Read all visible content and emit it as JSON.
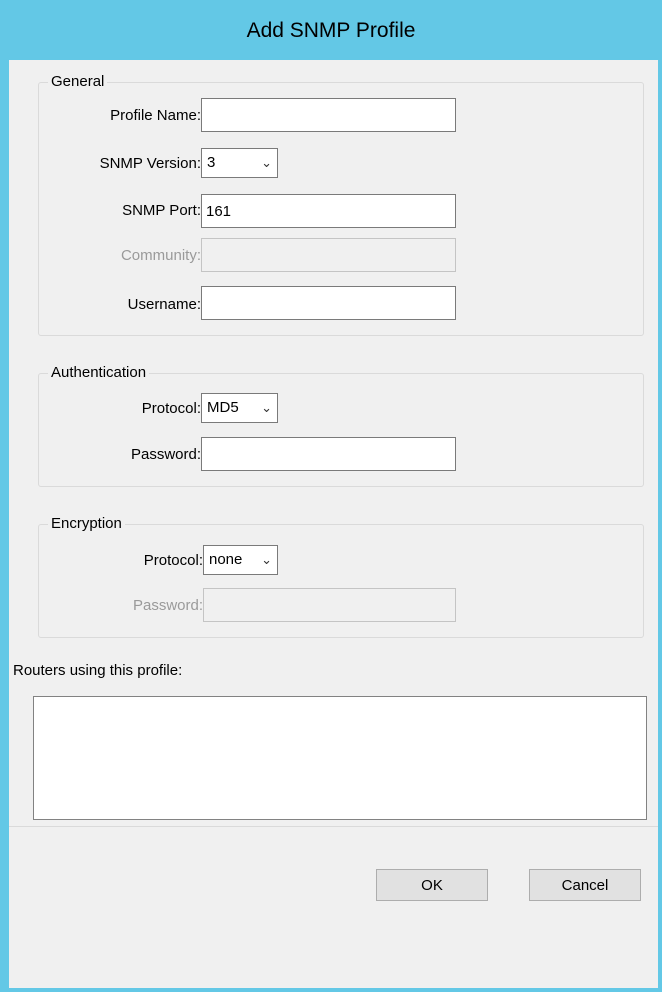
{
  "window": {
    "title": "Add SNMP Profile"
  },
  "general": {
    "legend": "General",
    "profile_name": {
      "label": "Profile Name:",
      "value": ""
    },
    "snmp_version": {
      "label": "SNMP Version:",
      "value": "3"
    },
    "snmp_port": {
      "label": "SNMP Port:",
      "value": "161"
    },
    "community": {
      "label": "Community:",
      "value": "",
      "enabled": false
    },
    "username": {
      "label": "Username:",
      "value": ""
    }
  },
  "authentication": {
    "legend": "Authentication",
    "protocol": {
      "label": "Protocol:",
      "value": "MD5"
    },
    "password": {
      "label": "Password:",
      "value": ""
    }
  },
  "encryption": {
    "legend": "Encryption",
    "protocol": {
      "label": "Protocol:",
      "value": "none"
    },
    "password": {
      "label": "Password:",
      "value": "",
      "enabled": false
    }
  },
  "routers": {
    "label": "Routers using this profile:",
    "items": []
  },
  "buttons": {
    "ok": "OK",
    "cancel": "Cancel"
  },
  "icons": {
    "dropdown": "chevron-down-icon"
  },
  "colors": {
    "titlebar": "#63c8e6",
    "dialog_bg": "#f0f0f0",
    "disabled_text": "#9a9a9a"
  }
}
